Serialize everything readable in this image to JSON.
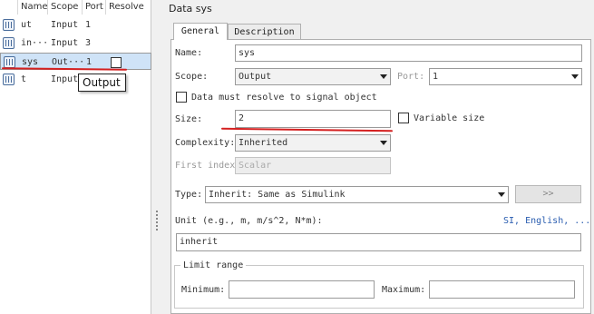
{
  "variables_table": {
    "columns": [
      "Name",
      "Scope",
      "Port",
      "Resolve"
    ],
    "rows": [
      {
        "name": "ut",
        "scope": "Input",
        "port": "1",
        "resolve": false,
        "selected": false
      },
      {
        "name": "in···",
        "scope": "Input",
        "port": "3",
        "resolve": false,
        "selected": false
      },
      {
        "name": "sys",
        "scope": "Out···",
        "port": "1",
        "resolve": false,
        "selected": true
      },
      {
        "name": "t",
        "scope": "Input",
        "port": "",
        "resolve": false,
        "selected": false
      }
    ],
    "tooltip": "Output"
  },
  "panel": {
    "title": "Data sys",
    "tabs": [
      "General",
      "Description"
    ],
    "active_tab": "General"
  },
  "form": {
    "name_label": "Name:",
    "name_value": "sys",
    "scope_label": "Scope:",
    "scope_value": "Output",
    "port_label": "Port:",
    "port_value": "1",
    "resolve_label": "Data must resolve to signal object",
    "size_label": "Size:",
    "size_value": "2",
    "variable_size_label": "Variable size",
    "complexity_label": "Complexity:",
    "complexity_value": "Inherited",
    "first_index_label": "First index",
    "first_index_value": "Scalar",
    "type_label": "Type:",
    "type_value": "Inherit: Same as Simulink",
    "type_button": ">>",
    "unit_label": "Unit (e.g., m, m/s^2, N*m):",
    "unit_link": "SI, English, ...",
    "unit_value": "inherit",
    "limit_range_label": "Limit range",
    "minimum_label": "Minimum:",
    "minimum_value": "",
    "maximum_label": "Maximum:",
    "maximum_value": ""
  },
  "colors": {
    "selection": "#cfe3f7",
    "annotation": "#d42020",
    "link": "#2a5db0"
  }
}
